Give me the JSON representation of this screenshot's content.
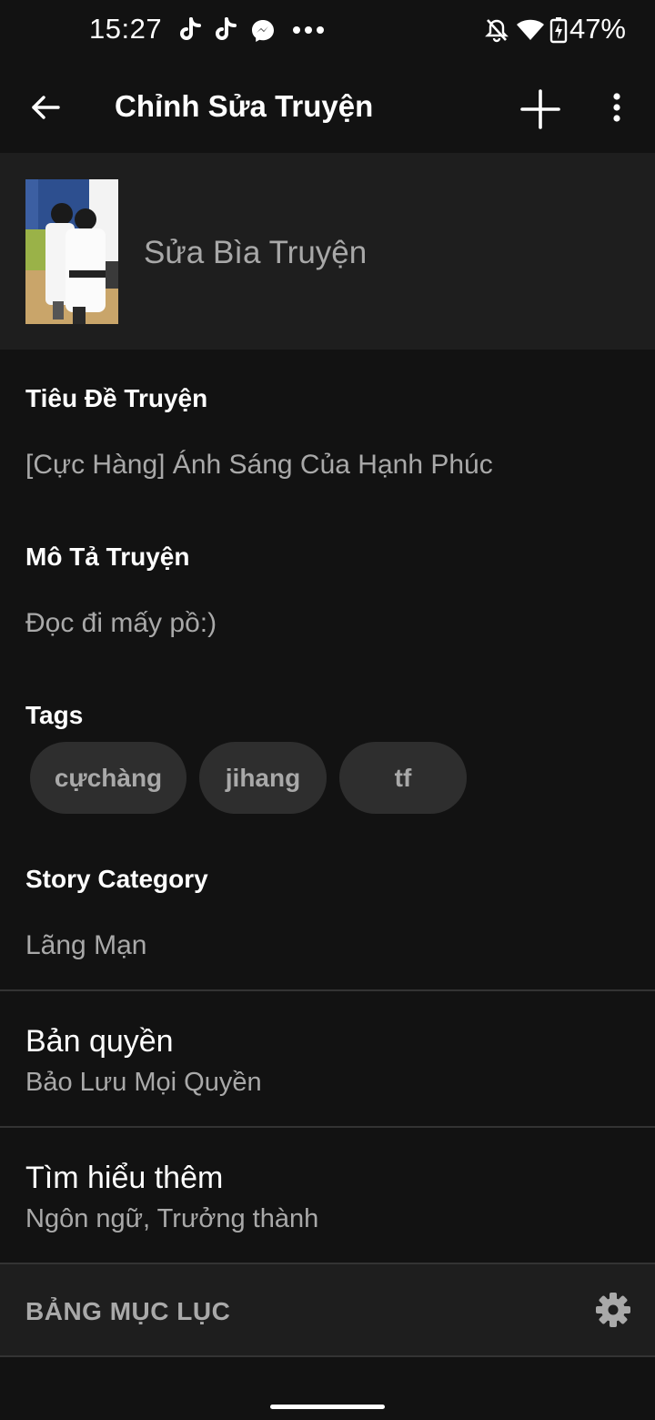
{
  "status_bar": {
    "time": "15:27",
    "notification_icons": [
      "tiktok-icon",
      "tiktok-icon",
      "messenger-icon",
      "more-dots-icon"
    ],
    "system_icons": [
      "muted-bell-icon",
      "wifi-icon",
      "battery-charging-icon"
    ],
    "battery_percent": "47%"
  },
  "app_bar": {
    "title": "Chỉnh Sửa Truyện",
    "back_icon": "arrow-back-icon",
    "add_icon": "plus-icon",
    "more_icon": "more-vertical-icon"
  },
  "cover": {
    "label": "Sửa Bìa Truyện"
  },
  "story_title": {
    "label": "Tiêu Đề Truyện",
    "value": "[Cực Hàng] Ánh Sáng Của Hạnh Phúc"
  },
  "description": {
    "label": "Mô Tả Truyện",
    "value": "Đọc đi mấy pồ:)"
  },
  "tags": {
    "label": "Tags",
    "items": [
      "cựchàng",
      "jihang",
      "tf"
    ]
  },
  "category": {
    "label": "Story Category",
    "value": "Lãng Mạn"
  },
  "copyright": {
    "title": "Bản quyền",
    "subtitle": "Bảo Lưu Mọi Quyền"
  },
  "more_info": {
    "title": "Tìm hiểu thêm",
    "subtitle": "Ngôn ngữ, Trưởng thành"
  },
  "toc": {
    "title": "BẢNG MỤC LỤC",
    "settings_icon": "gear-icon"
  },
  "colors": {
    "background": "#121212",
    "surface": "#1e1e1e",
    "chip": "#2e2e2e",
    "secondary_text": "#a9a9a9"
  }
}
